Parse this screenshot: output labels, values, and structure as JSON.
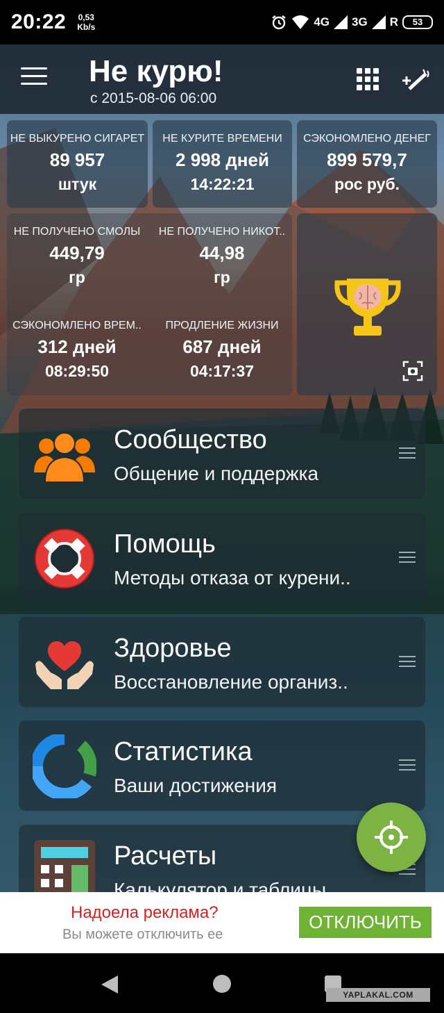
{
  "status_bar": {
    "time": "20:22",
    "speed_value": "0,53",
    "speed_unit": "Kb/s",
    "net1": "4G",
    "net2": "3G",
    "roaming": "R",
    "battery": "53"
  },
  "header": {
    "title": "Не курю!",
    "since": "с 2015-08-06 06:00"
  },
  "stats": {
    "not_smoked": {
      "label": "НЕ ВЫКУРЕНО СИГАРЕТ",
      "value": "89 957",
      "unit": "штук"
    },
    "not_smoking_time": {
      "label": "НЕ КУРИТЕ ВРЕМЕНИ",
      "value": "2 998 дней",
      "unit": "14:22:21"
    },
    "money_saved": {
      "label": "СЭКОНОМЛЕНО ДЕНЕГ",
      "value": "899 579,7",
      "unit": "рос руб."
    },
    "tar": {
      "label": "НЕ ПОЛУЧЕНО СМОЛЫ",
      "value": "449,79",
      "unit": "гр"
    },
    "nicotine": {
      "label": "НЕ ПОЛУЧЕНО НИКОТ..",
      "value": "44,98",
      "unit": "гр"
    },
    "time_saved": {
      "label": "СЭКОНОМЛЕНО ВРЕМ..",
      "value": "312 дней",
      "unit": "08:29:50"
    },
    "life_extension": {
      "label": "ПРОДЛЕНИЕ ЖИЗНИ",
      "value": "687 дней",
      "unit": "04:17:37"
    }
  },
  "menu": [
    {
      "title": "Сообщество",
      "subtitle": "Общение и поддержка",
      "icon": "community-icon"
    },
    {
      "title": "Помощь",
      "subtitle": "Методы отказа от курени..",
      "icon": "lifebuoy-icon"
    },
    {
      "title": "Здоровье",
      "subtitle": "Восстановление организ..",
      "icon": "heart-hands-icon"
    },
    {
      "title": "Статистика",
      "subtitle": "Ваши достижения",
      "icon": "statistics-icon"
    },
    {
      "title": "Расчеты",
      "subtitle": "Калькулятор и таблицы",
      "icon": "calculator-icon"
    }
  ],
  "ad": {
    "title": "Надоела реклама?",
    "subtitle": "Вы можете отключить ее",
    "button": "ОТКЛЮЧИТЬ"
  },
  "watermark": "YAPLAKAL.COM",
  "colors": {
    "accent_green": "#7cb342",
    "ad_red": "#d32222",
    "trophy_gold": "#f5c518"
  }
}
